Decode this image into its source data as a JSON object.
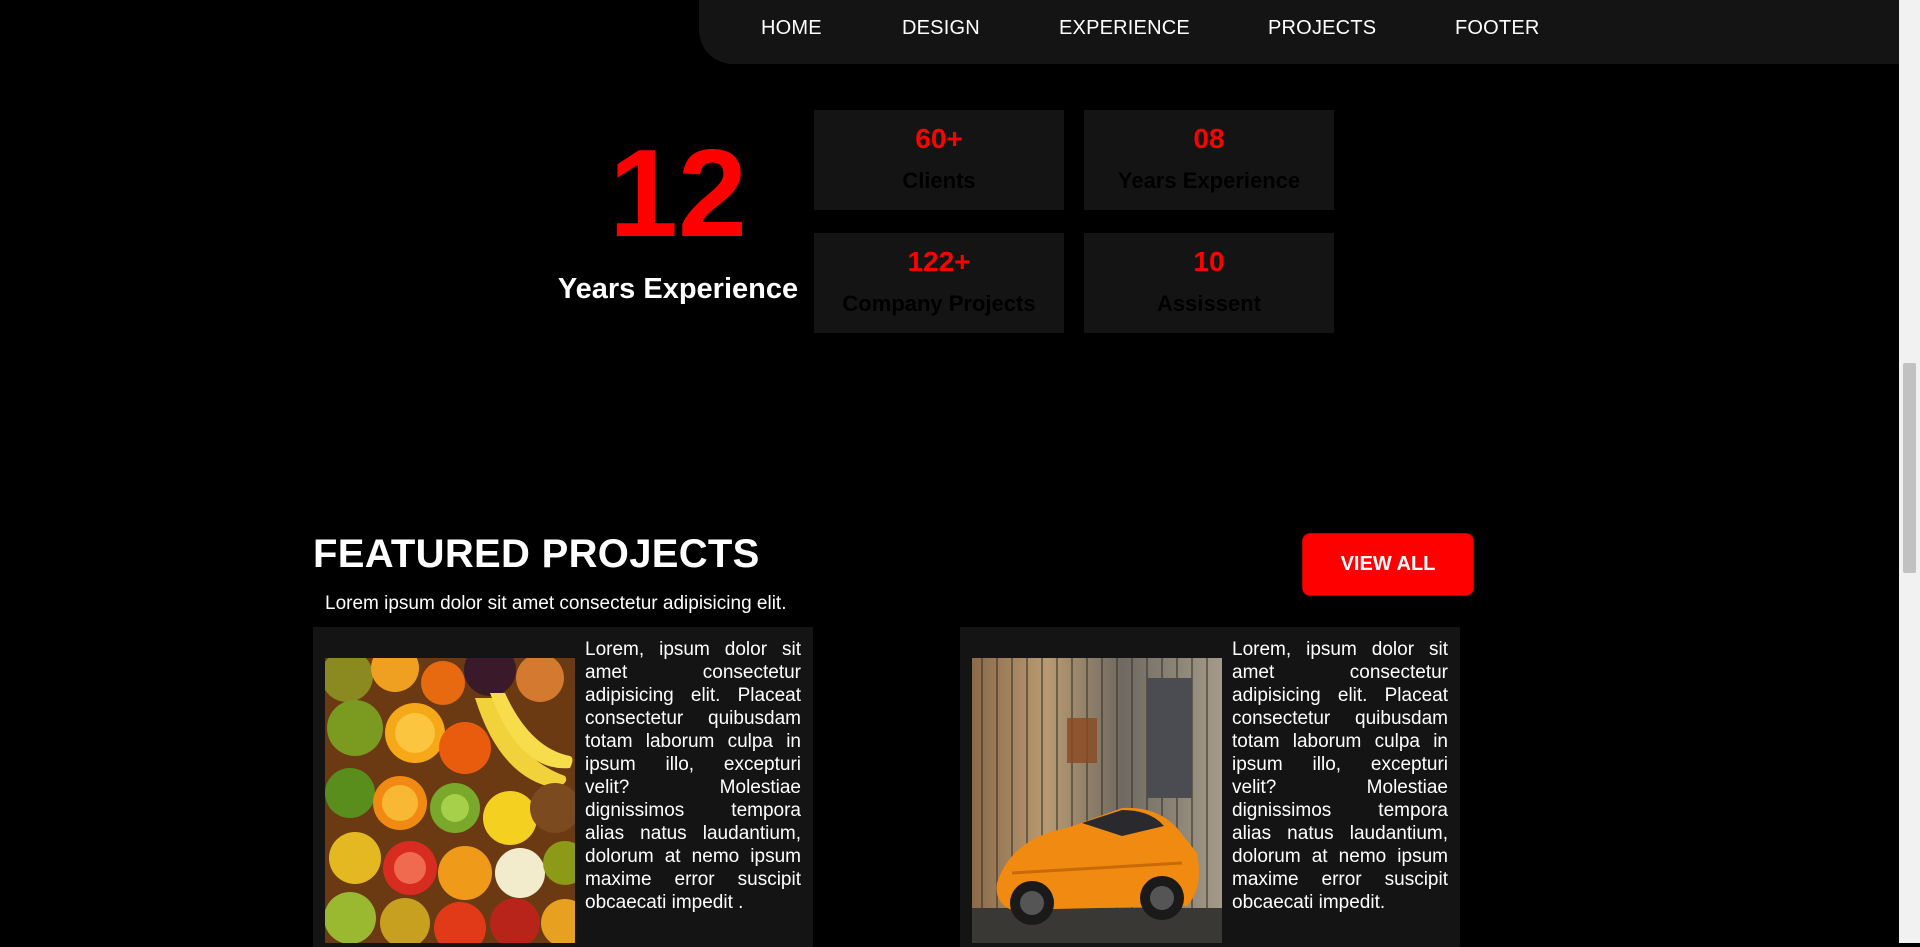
{
  "nav": {
    "items": [
      "HOME",
      "DESIGN",
      "EXPERIENCE",
      "PROJECTS",
      "FOOTER"
    ]
  },
  "experience": {
    "big_number": "12",
    "big_label": "Years Experience",
    "stats": [
      {
        "value": "60+",
        "label": "Clients"
      },
      {
        "value": "08",
        "label": "Years Experience"
      },
      {
        "value": "122+",
        "label": "Company Projects"
      },
      {
        "value": "10",
        "label": "Assissent"
      }
    ]
  },
  "featured": {
    "title": "FEATURED PROJECTS",
    "subtitle": "Lorem ipsum dolor sit amet consectetur adipisicing elit.",
    "view_all_label": "VIEW ALL",
    "cards": [
      {
        "text": "Lorem, ipsum dolor sit amet consectetur adipisicing elit. Placeat consectetur quibusdam totam laborum culpa in ipsum illo, excepturi velit? Molestiae dignissimos tempora alias natus laudantium, dolorum at nemo ipsum maxime error suscipit obcaecati impedit .",
        "image": "fruits-image"
      },
      {
        "text": "Lorem, ipsum dolor sit amet consectetur adipisicing elit. Placeat consectetur quibusdam totam laborum culpa in ipsum illo, excepturi velit? Molestiae dignissimos tempora alias natus laudantium, dolorum at nemo ipsum maxime error suscipit obcaecati impedit.",
        "image": "orange-sports-car-image"
      }
    ]
  },
  "colors": {
    "accent": "#ff0000",
    "panel": "#141414",
    "background": "#000000"
  }
}
